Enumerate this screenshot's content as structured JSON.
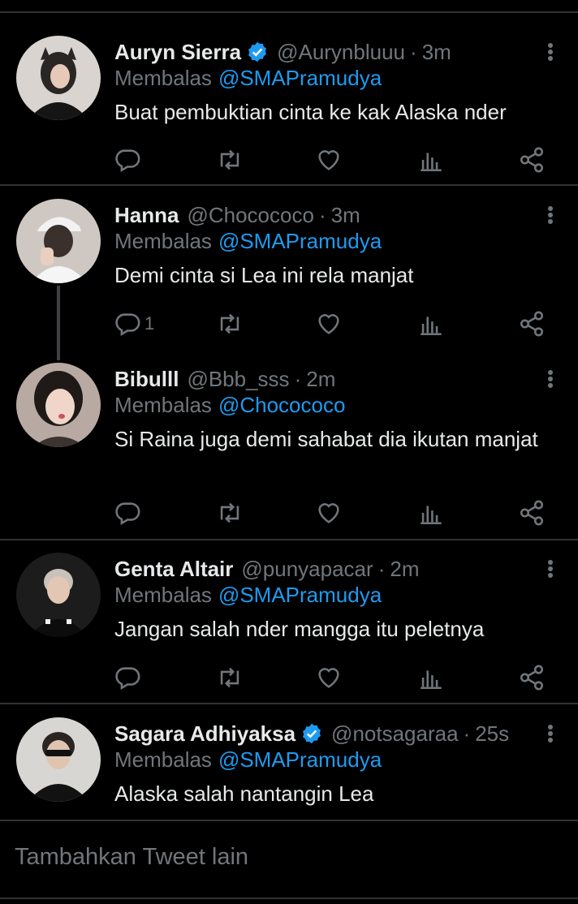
{
  "colors": {
    "background": "#000000",
    "text": "#e7e9ea",
    "muted": "#71767b",
    "accent": "#1d9bf0",
    "divider": "#2f3336"
  },
  "reply_prefix": "Membalas",
  "tweets": [
    {
      "name": "Auryn Sierra",
      "verified": true,
      "handle": "@Aurynbluuu",
      "time": "3m",
      "reply_to": "@SMAPramudya",
      "text": "Buat pembuktian cinta ke kak Alaska nder",
      "reply_count": ""
    },
    {
      "name": "Hanna",
      "verified": false,
      "handle": "@Chocococo",
      "time": "3m",
      "reply_to": "@SMAPramudya",
      "text": "Demi cinta si Lea ini rela manjat",
      "reply_count": "1"
    },
    {
      "name": "Bibulll",
      "verified": false,
      "handle": "@Bbb_sss",
      "time": "2m",
      "reply_to": "@Chocococo",
      "text": "Si Raina juga demi sahabat dia ikutan manjat",
      "reply_count": ""
    },
    {
      "name": "Genta Altair",
      "verified": false,
      "handle": "@punyapacar",
      "time": "2m",
      "reply_to": "@SMAPramudya",
      "text": "Jangan salah nder mangga itu peletnya",
      "reply_count": ""
    },
    {
      "name": "Sagara Adhiyaksa",
      "verified": true,
      "handle": "@notsagaraa",
      "time": "25s",
      "reply_to": "@SMAPramudya",
      "text": "Alaska salah nantangin Lea",
      "reply_count": ""
    }
  ],
  "dot_sep": "·",
  "add_tweet_placeholder": "Tambahkan Tweet lain",
  "icons": {
    "reply": "reply-icon",
    "retweet": "retweet-icon",
    "like": "heart-icon",
    "views": "views-icon",
    "share": "share-icon",
    "more": "more-vertical-icon",
    "verified": "verified-badge-icon"
  }
}
